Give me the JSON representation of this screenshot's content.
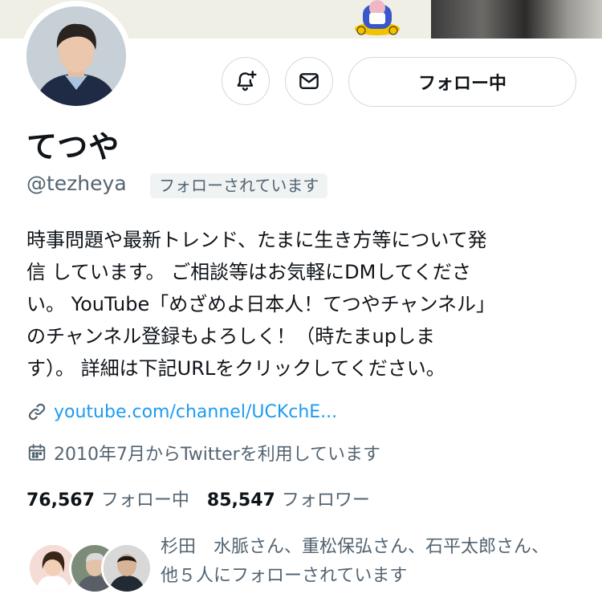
{
  "profile": {
    "display_name": "てつや",
    "handle": "@tezheya",
    "follows_you_badge": "フォローされています",
    "bio": "時事問題や最新トレンド、たまに生き方等について発\n信 しています。 ご相談等はお気軽にDMしてくださ\nい。 YouTube「めざめよ日本人！てつやチャンネル」\nのチャンネル登録もよろしく！（時たまupしま\nす）。 詳細は下記URLをクリックしてください。",
    "link": "youtube.com/channel/UCKchE...",
    "joined": "2010年7月からTwitterを利用しています"
  },
  "actions": {
    "notify_icon": "bell-plus-icon",
    "message_icon": "envelope-icon",
    "follow_label": "フォロー中"
  },
  "stats": {
    "following_count": "76,567",
    "following_label": "フォロー中",
    "followers_count": "85,547",
    "followers_label": "フォロワー"
  },
  "followed_by": {
    "text": "杉田　水脈さん、重松保弘さん、石平太郎さん、他５人にフォローされています"
  },
  "colors": {
    "link": "#1d9bf0",
    "secondary_text": "#536471",
    "border": "#cfd9de"
  }
}
